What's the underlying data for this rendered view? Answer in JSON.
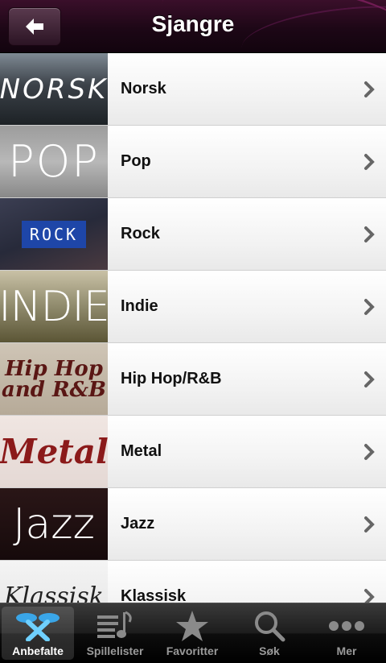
{
  "header": {
    "title": "Sjangre",
    "back_icon": "back-arrow-icon"
  },
  "genres": [
    {
      "label": "Norsk",
      "thumb_text": "NORSK"
    },
    {
      "label": "Pop",
      "thumb_text": "POP"
    },
    {
      "label": "Rock",
      "thumb_text": "ROCK"
    },
    {
      "label": "Indie",
      "thumb_text": "INDIE"
    },
    {
      "label": "Hip Hop/R&B",
      "thumb_text": "Hip Hop and R&B"
    },
    {
      "label": "Metal",
      "thumb_text": "Metal"
    },
    {
      "label": "Jazz",
      "thumb_text": "Jazz"
    },
    {
      "label": "Klassisk",
      "thumb_text": "Klassisk"
    }
  ],
  "tabs": [
    {
      "label": "Anbefalte",
      "icon": "recommended-icon",
      "active": true
    },
    {
      "label": "Spillelister",
      "icon": "playlist-icon",
      "active": false
    },
    {
      "label": "Favoritter",
      "icon": "star-icon",
      "active": false
    },
    {
      "label": "Søk",
      "icon": "search-icon",
      "active": false
    },
    {
      "label": "Mer",
      "icon": "more-icon",
      "active": false
    }
  ],
  "colors": {
    "header_bg": "#1d0716",
    "tab_active_label": "#ffffff",
    "tab_inactive_label": "#9a9a9a"
  }
}
